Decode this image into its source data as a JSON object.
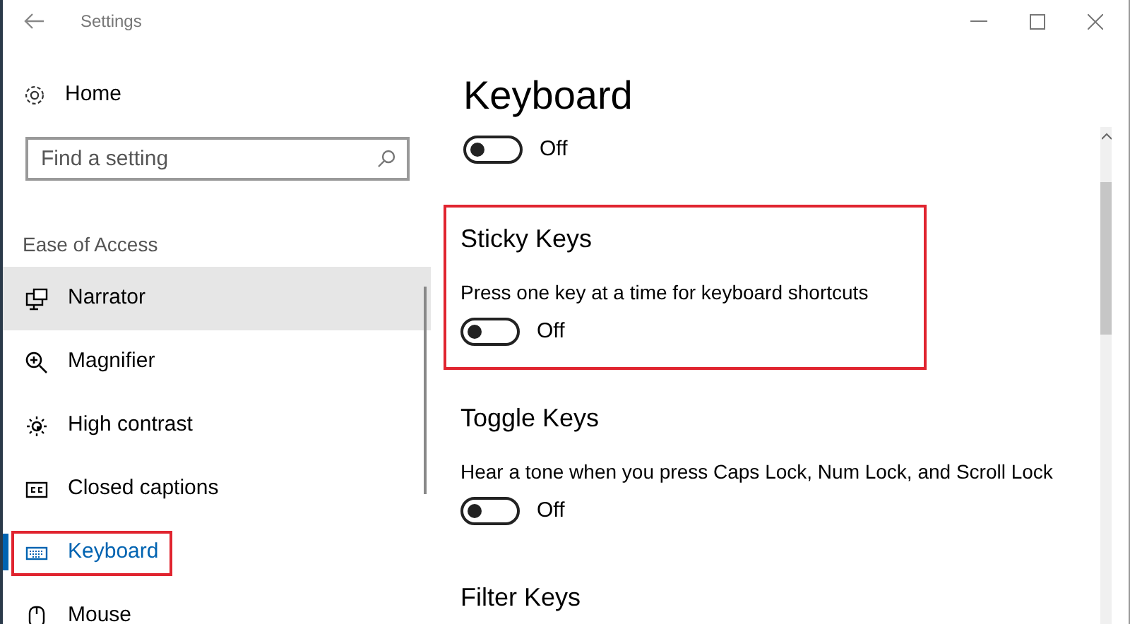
{
  "window": {
    "title": "Settings"
  },
  "sidebar": {
    "home": "Home",
    "search": {
      "placeholder": "Find a setting"
    },
    "group": "Ease of Access",
    "items": [
      {
        "label": "Narrator",
        "selected": false,
        "hovered": true,
        "highlighted": false
      },
      {
        "label": "Magnifier",
        "selected": false,
        "hovered": false,
        "highlighted": false
      },
      {
        "label": "High contrast",
        "selected": false,
        "hovered": false,
        "highlighted": false
      },
      {
        "label": "Closed captions",
        "selected": false,
        "hovered": false,
        "highlighted": false
      },
      {
        "label": "Keyboard",
        "selected": true,
        "hovered": false,
        "highlighted": true
      },
      {
        "label": "Mouse",
        "selected": false,
        "hovered": false,
        "highlighted": false
      }
    ]
  },
  "page": {
    "title": "Keyboard",
    "top_toggle": {
      "on": false,
      "label": "Off"
    },
    "sections": [
      {
        "title": "Sticky Keys",
        "description": "Press one key at a time for keyboard shortcuts",
        "toggle": {
          "on": false,
          "label": "Off"
        },
        "highlighted": true
      },
      {
        "title": "Toggle Keys",
        "description": "Hear a tone when you press Caps Lock, Num Lock, and Scroll Lock",
        "toggle": {
          "on": false,
          "label": "Off"
        },
        "highlighted": false
      },
      {
        "title": "Filter Keys",
        "highlighted": false
      }
    ]
  }
}
